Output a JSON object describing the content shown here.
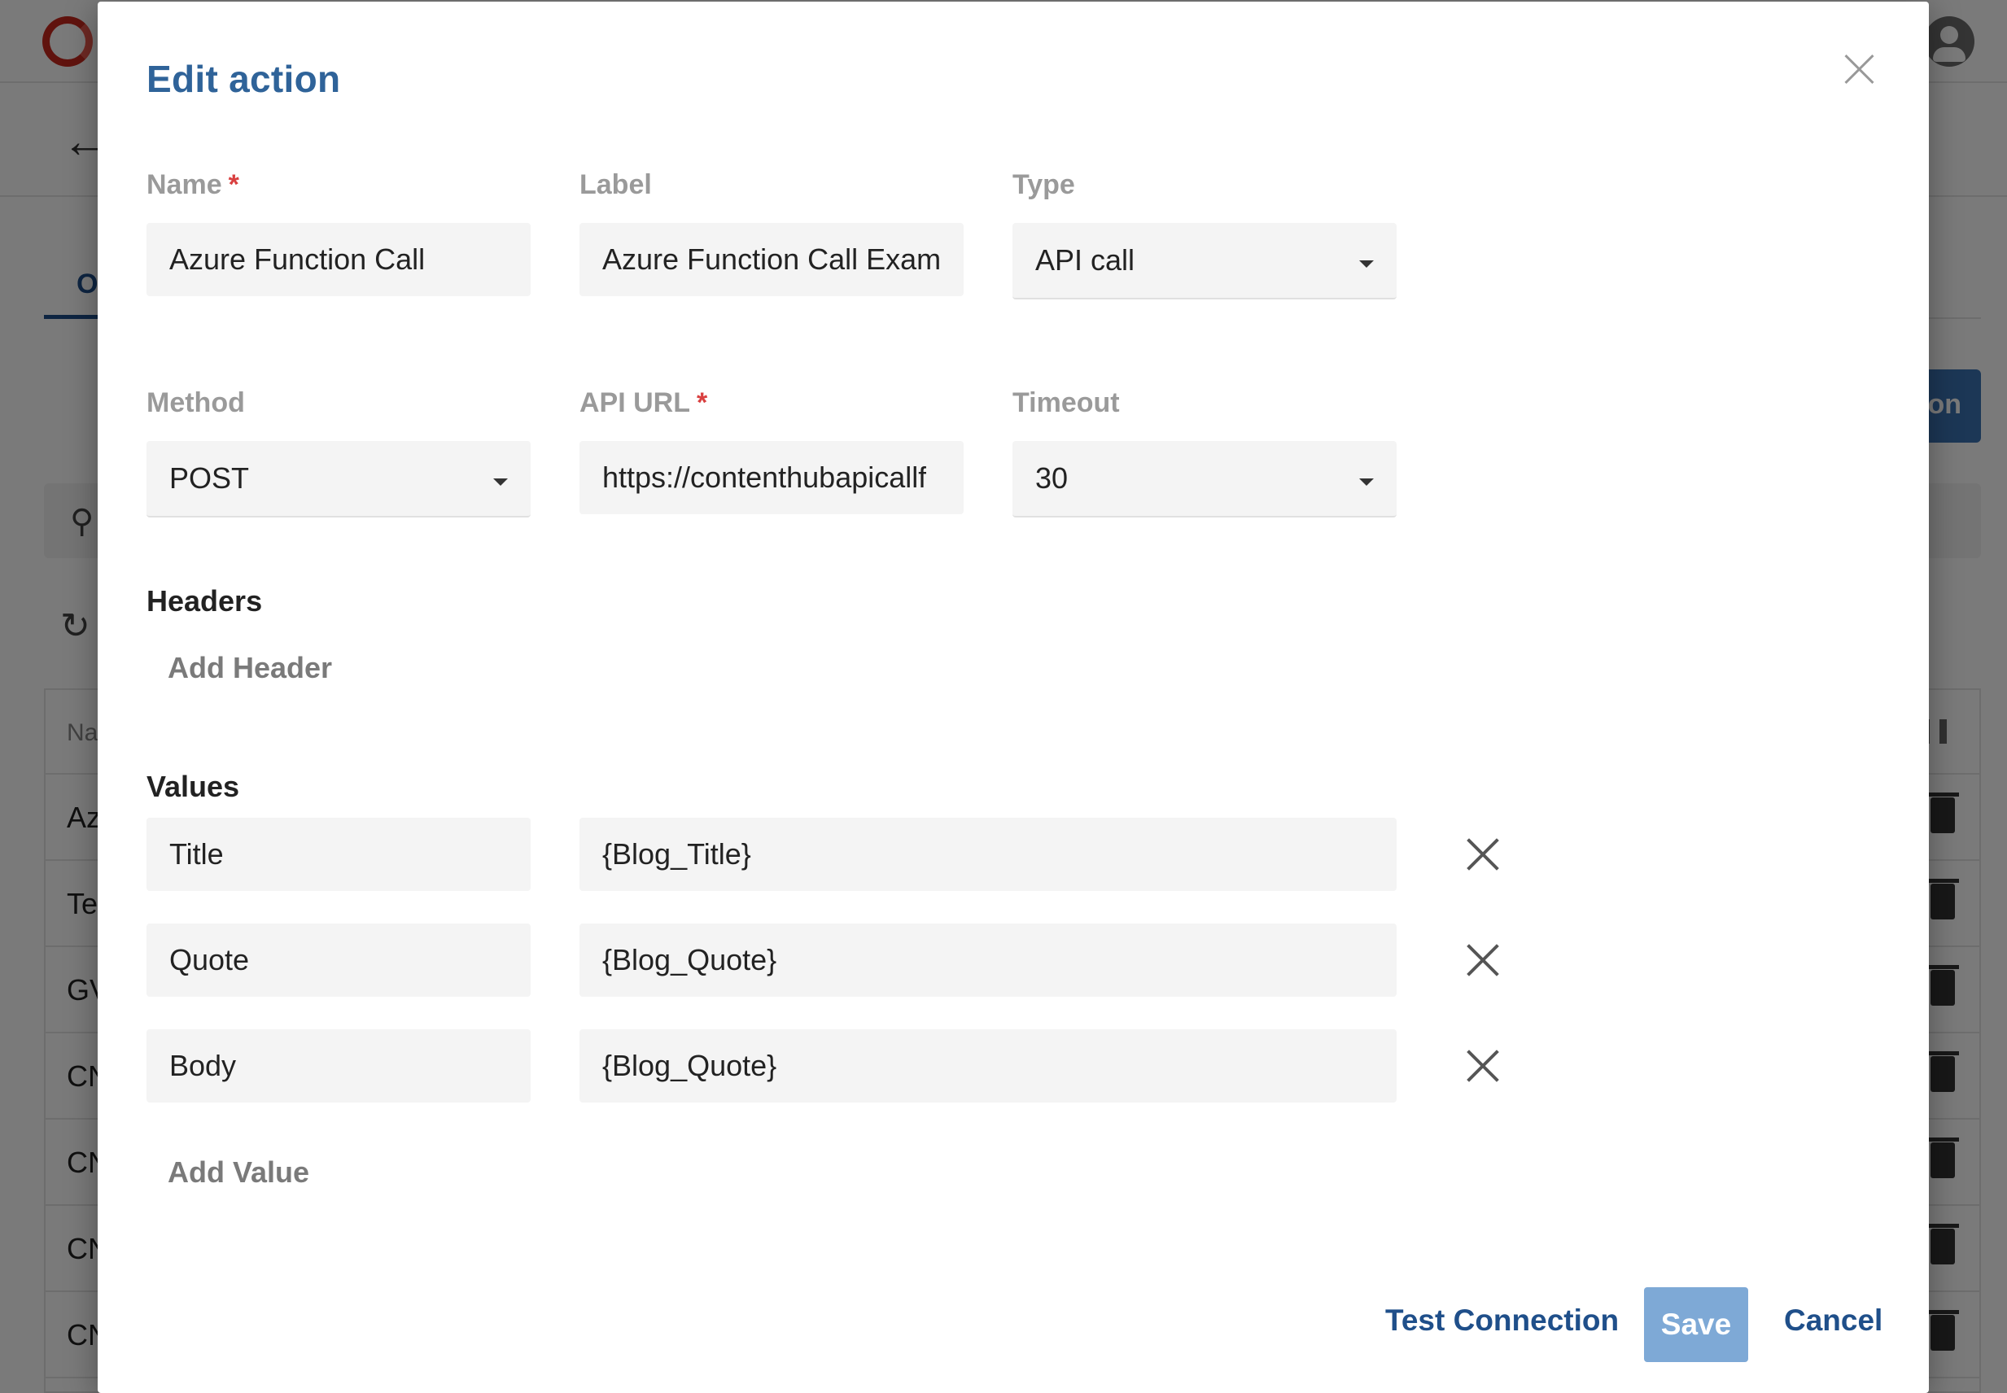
{
  "background": {
    "tab_active": "O",
    "new_button_label": "on",
    "table_header_name": "Na",
    "rows": [
      "Az",
      "Te",
      "GV",
      "CN",
      "CN",
      "CN",
      "CN"
    ]
  },
  "dialog": {
    "title": "Edit action",
    "fields": {
      "name": {
        "label": "Name",
        "required": "*",
        "value": "Azure Function Call"
      },
      "label": {
        "label": "Label",
        "value": "Azure Function Call Examp"
      },
      "type": {
        "label": "Type",
        "value": "API call"
      },
      "method": {
        "label": "Method",
        "value": "POST"
      },
      "api_url": {
        "label": "API URL",
        "required": "*",
        "value": "https://contenthubapicallf"
      },
      "timeout": {
        "label": "Timeout",
        "value": "30"
      }
    },
    "headers": {
      "title": "Headers",
      "add_label": "Add Header"
    },
    "values": {
      "title": "Values",
      "items": [
        {
          "key": "Title",
          "value": "{Blog_Title}"
        },
        {
          "key": "Quote",
          "value": "{Blog_Quote}"
        },
        {
          "key": "Body",
          "value": "{Blog_Quote}"
        }
      ],
      "add_label": "Add Value"
    },
    "footer": {
      "test_label": "Test Connection",
      "save_label": "Save",
      "cancel_label": "Cancel"
    }
  },
  "colors": {
    "title_blue": "#2f6399",
    "link_blue": "#1f4f8a",
    "save_button": "#7ea9d6",
    "required_red": "#d94040"
  }
}
